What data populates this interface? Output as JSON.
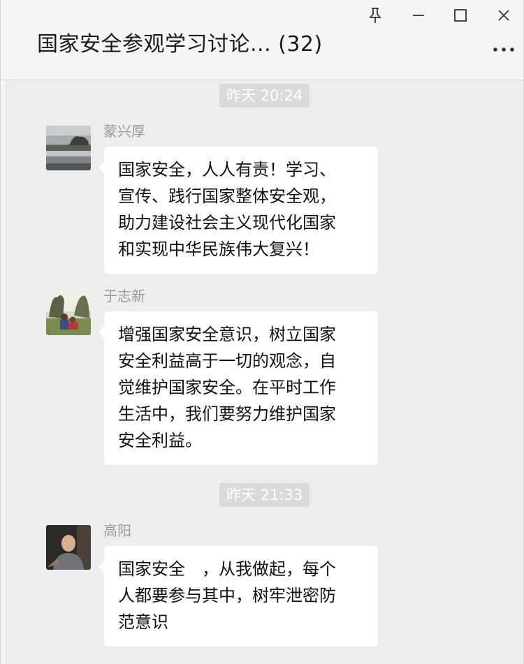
{
  "window": {
    "title": "国家安全参观学习讨论... (32)",
    "controls": {
      "pin": "pin-icon",
      "minimize": "minimize-icon",
      "maximize": "maximize-icon",
      "close": "close-icon",
      "more": "more-icon"
    }
  },
  "chat": {
    "time_separators": [
      "昨天 20:24",
      "昨天 21:33"
    ],
    "messages": [
      {
        "sender": "蒙兴厚",
        "avatar": "landscape-photo-avatar",
        "text": "国家安全，人人有责！学习、\n宣传、践行国家整体安全观，\n助力建设社会主义现代化国家\n和实现中华民族伟大复兴！"
      },
      {
        "sender": "于志新",
        "avatar": "outdoor-people-photo-avatar",
        "text": "增强国家安全意识，树立国家\n安全利益高于一切的观念，自\n觉维护国家安全。在平时工作\n生活中，我们要努力维护国家\n安全利益。"
      },
      {
        "sender": "高阳",
        "avatar": "portrait-photo-avatar",
        "text": "国家安全　，从我做起，每个\n人都要参与其中，树牢泄密防\n范意识"
      }
    ]
  }
}
